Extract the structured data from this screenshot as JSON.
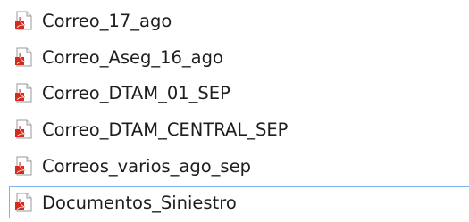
{
  "file_list": {
    "icon": "pdf-file-icon",
    "accent_color": "#d52b1e",
    "focus_border_color": "#7eb4ea",
    "items": [
      {
        "name": "Correo_17_ago"
      },
      {
        "name": "Correo_Aseg_16_ago"
      },
      {
        "name": "Correo_DTAM_01_SEP"
      },
      {
        "name": "Correo_DTAM_CENTRAL_SEP"
      },
      {
        "name": "Correos_varios_ago_sep"
      },
      {
        "name": "Documentos_Siniestro",
        "focused": true
      }
    ]
  }
}
